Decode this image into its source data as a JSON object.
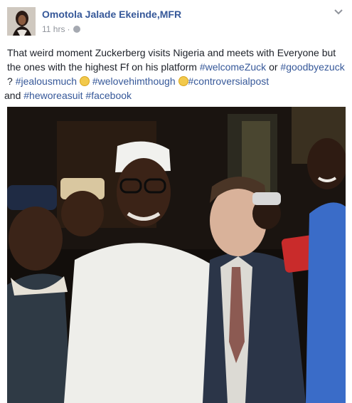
{
  "post": {
    "author": "Omotola Jalade Ekeinde,MFR",
    "time": "11 hrs",
    "separator": "·",
    "body": {
      "line1": "That weird moment Zuckerberg visits Nigeria and meets with Everyone but the ones with the highest Ff on his platform ",
      "tag1": "#welcomeZuck",
      "or": " or",
      "tag2": "#goodbyezuck",
      "q": " ? ",
      "tag3": "#jealousmuch",
      "tag4": "#welovehimthough",
      "tag5": "#controversialpost",
      "and": " and ",
      "tag6": "#heworeasuit",
      "tag7": "#facebook"
    }
  },
  "icons": {
    "privacy": "globe-icon",
    "menu": "chevron-down-icon",
    "emoji1": "grinning-face-icon",
    "emoji2": "relieved-face-icon"
  },
  "colors": {
    "link": "#365899",
    "meta": "#90949c",
    "text": "#1d2129"
  }
}
